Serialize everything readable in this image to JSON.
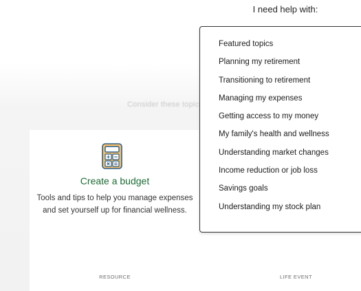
{
  "header": {
    "help_label": "I need help with:"
  },
  "dropdown": {
    "items": [
      "Featured topics",
      "Planning my retirement",
      "Transitioning to retirement",
      "Managing my expenses",
      "Getting access to my money",
      "My family's health and wellness",
      "Understanding market changes",
      "Income reduction or job loss",
      "Savings goals",
      "Understanding my stock plan"
    ]
  },
  "background": {
    "faded_text": "Consider these topics"
  },
  "cards": {
    "left": {
      "icon": "calculator-icon",
      "title": "Create a budget",
      "description": "Tools and tips to help you manage expenses and set yourself up for financial wellness.",
      "tag": "RESOURCE"
    },
    "right": {
      "tag": "LIFE EVENT"
    }
  },
  "colors": {
    "title_green": "#1c6a34",
    "icon_accent": "#f0a83a",
    "icon_body": "#2e5f8a"
  }
}
